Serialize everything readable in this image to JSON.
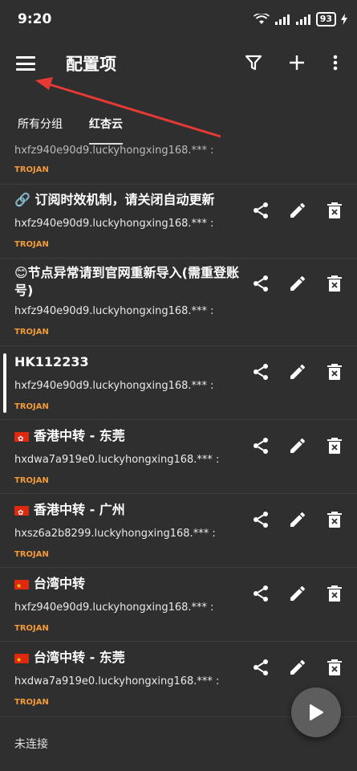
{
  "status_bar": {
    "time": "9:20",
    "battery": "93"
  },
  "toolbar": {
    "title": "配置项"
  },
  "tabs": [
    {
      "label": "所有分组",
      "selected": false
    },
    {
      "label": "红杏云",
      "selected": true
    }
  ],
  "list": {
    "partial_top": {
      "address": "hxfz940e90d9.luckyhongxing168.*** :",
      "type": "TROJAN"
    },
    "items": [
      {
        "name": "🔗 订阅时效机制，请关闭自动更新",
        "address": "hxfz940e90d9.luckyhongxing168.*** :",
        "type": "TROJAN",
        "selected": false
      },
      {
        "name": "😊节点异常请到官网重新导入(需重登账号)",
        "address": "hxfz940e90d9.luckyhongxing168.*** :",
        "type": "TROJAN",
        "selected": false
      },
      {
        "name": "HK112233",
        "address": "hxfz940e90d9.luckyhongxing168.*** :",
        "type": "TROJAN",
        "selected": true
      },
      {
        "flag": "hk",
        "name": "香港中转 - 东莞",
        "address": "hxdwa7a919e0.luckyhongxing168.*** :",
        "type": "TROJAN",
        "selected": false
      },
      {
        "flag": "hk",
        "name": "香港中转 - 广州",
        "address": "hxsz6a2b8299.luckyhongxing168.*** :",
        "type": "TROJAN",
        "selected": false
      },
      {
        "flag": "cn",
        "name": "台湾中转",
        "address": "hxfz940e90d9.luckyhongxing168.*** :",
        "type": "TROJAN",
        "selected": false
      },
      {
        "flag": "cn",
        "name": "台湾中转 - 东莞",
        "address": "hxdwa7a919e0.luckyhongxing168.*** :",
        "type": "TROJAN",
        "selected": false
      }
    ]
  },
  "bottom": {
    "status": "未连接"
  },
  "icons": {
    "menu": "menu-icon",
    "filter": "filter-icon",
    "add": "plus-icon",
    "more": "more-vert-icon",
    "share": "share-icon",
    "edit": "edit-icon",
    "delete": "delete-icon",
    "play": "play-icon"
  },
  "colors": {
    "background": "#2f2f2f",
    "type_label": "#f29a3a",
    "annotation_arrow": "#e53935"
  }
}
